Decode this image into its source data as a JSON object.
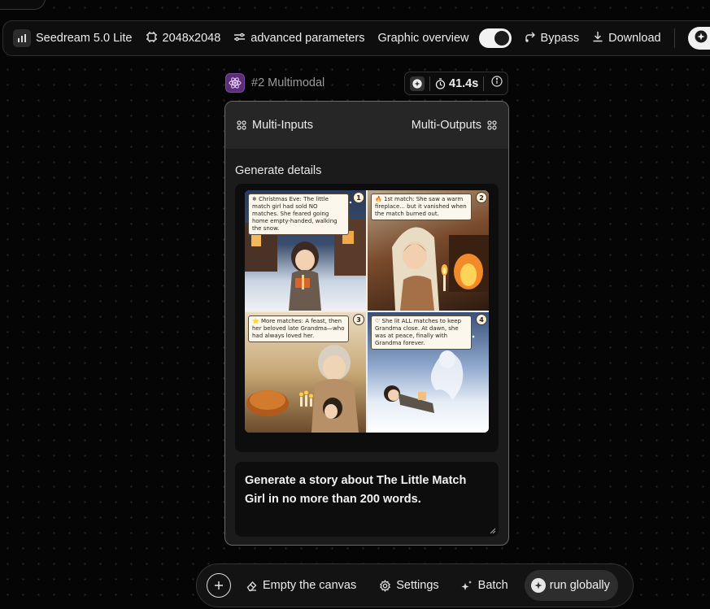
{
  "toolbar": {
    "model_label": "Seedream 5.0 Lite",
    "resolution_label": "2048x2048",
    "advanced_label": "advanced parameters",
    "overview_label": "Graphic overview",
    "overview_toggle_on": true,
    "bypass_label": "Bypass",
    "download_label": "Download"
  },
  "node": {
    "title": "#2 Multimodal",
    "duration": "41.4s",
    "inputs_label": "Multi-Inputs",
    "outputs_label": "Multi-Outputs",
    "section_label": "Generate details",
    "prompt": "Generate a story about The Little Match Girl in no more than 200 words.",
    "accent_color": "#5a2e78",
    "comic": {
      "panels": [
        {
          "num": "1",
          "caption": "❄ Christmas Eve: The little match girl had sold NO matches. She feared going home empty-handed, walking the snow."
        },
        {
          "num": "2",
          "caption": "🔥 1st match: She saw a warm fireplace... but it vanished when the match burned out."
        },
        {
          "num": "3",
          "caption": "⭐ More matches: A feast, then her beloved late Grandma—who had always loved her."
        },
        {
          "num": "4",
          "caption": "♡ She lit ALL matches to keep Grandma close. At dawn, she was at peace, finally with Grandma forever."
        }
      ]
    }
  },
  "dock": {
    "empty_label": "Empty the canvas",
    "settings_label": "Settings",
    "batch_label": "Batch",
    "run_label": "run globally"
  }
}
